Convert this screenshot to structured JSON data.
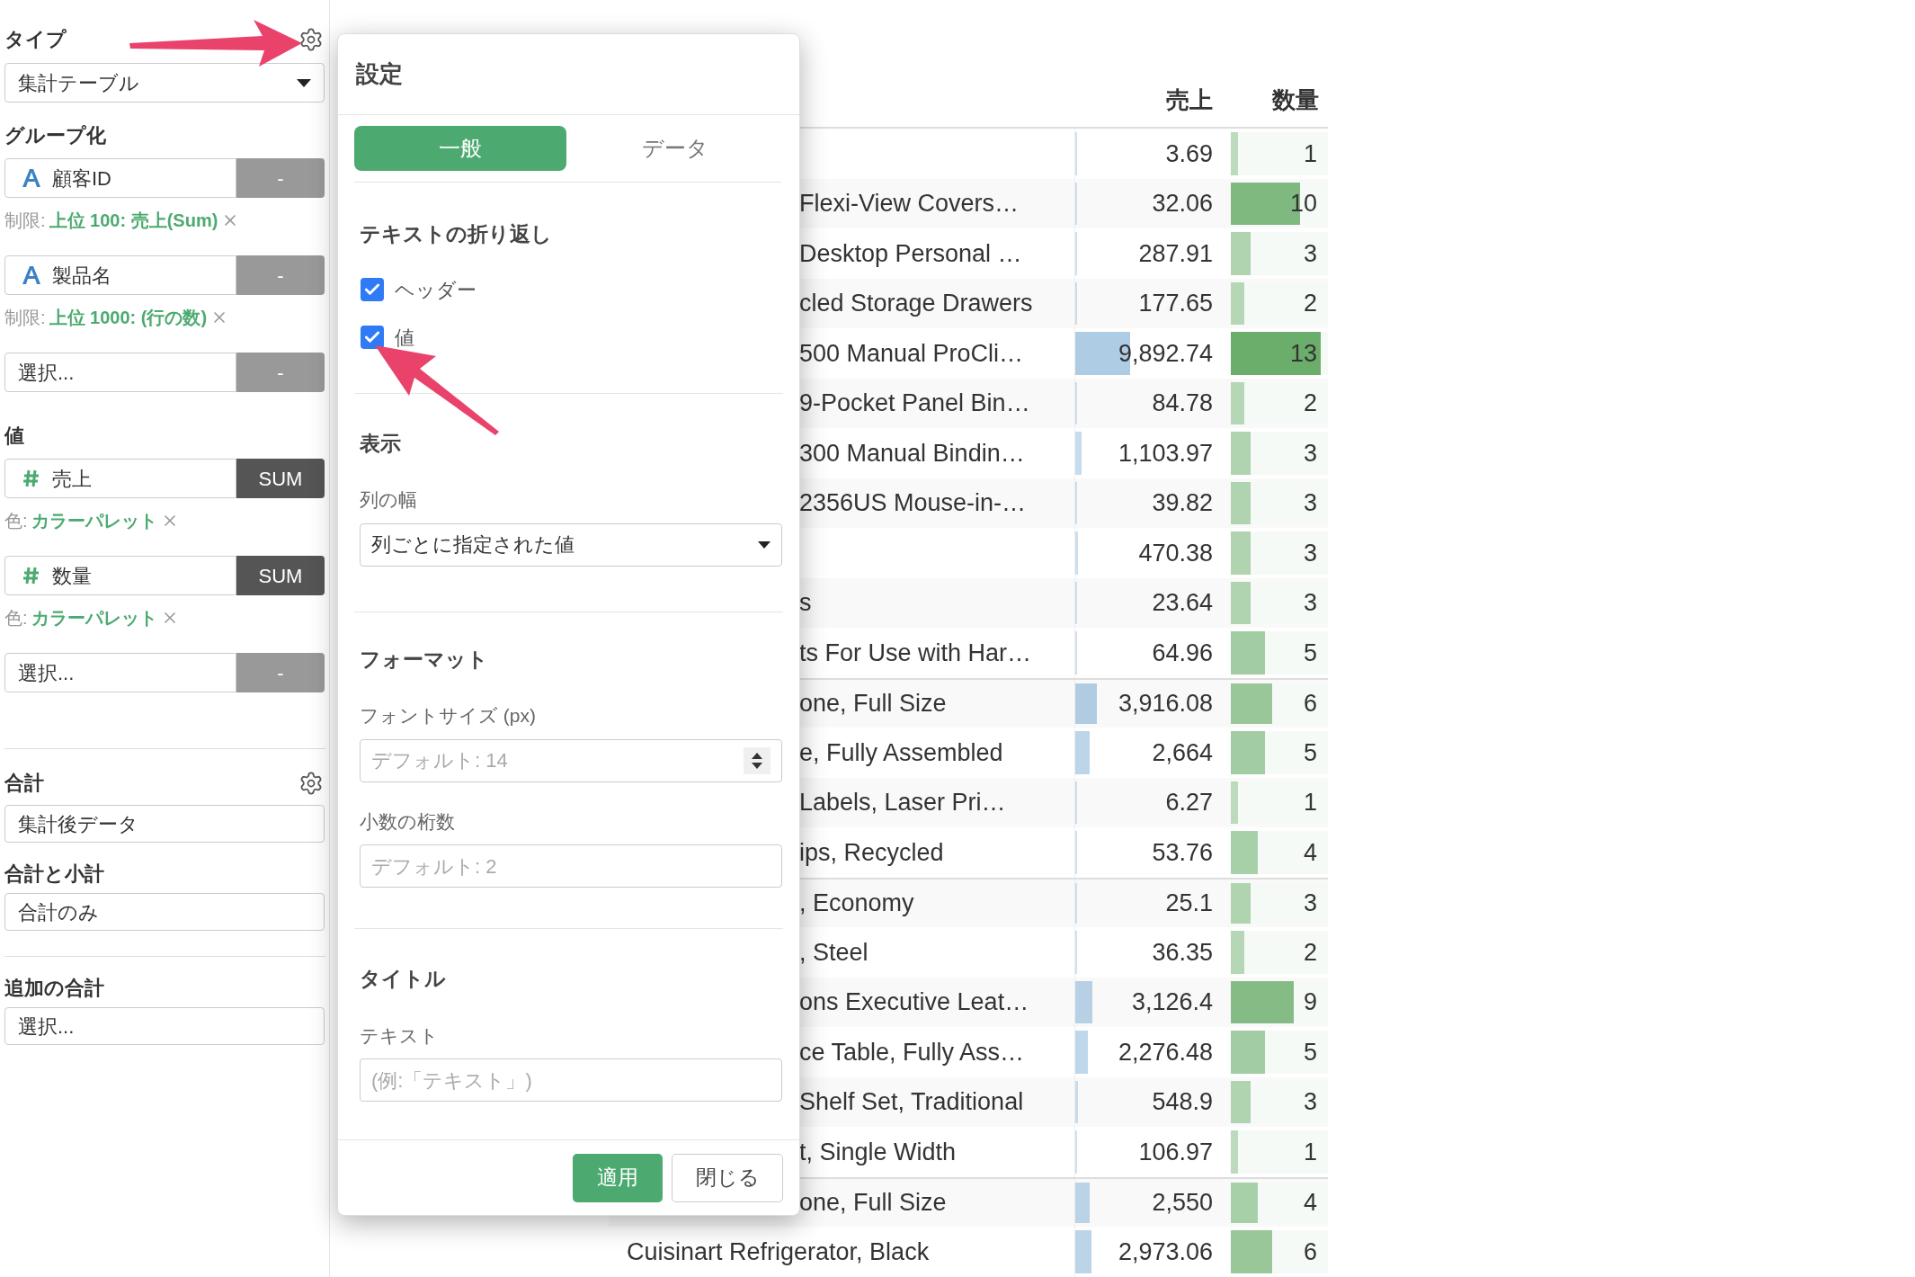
{
  "sidebar": {
    "type": {
      "label": "タイプ",
      "value": "集計テーブル"
    },
    "grouping": {
      "label": "グループ化",
      "fields": [
        {
          "kind": "text",
          "name": "顧客ID",
          "button": "-",
          "note_label": "制限:",
          "note_value": "上位 100: 売上(Sum)"
        },
        {
          "kind": "text",
          "name": "製品名",
          "button": "-",
          "note_label": "制限:",
          "note_value": "上位 1000: (行の数)"
        }
      ],
      "picker": {
        "placeholder": "選択...",
        "button": "-"
      }
    },
    "values": {
      "label": "値",
      "fields": [
        {
          "kind": "number",
          "name": "売上",
          "button": "SUM",
          "note_label": "色:",
          "note_value": "カラーパレット"
        },
        {
          "kind": "number",
          "name": "数量",
          "button": "SUM",
          "note_label": "色:",
          "note_value": "カラーパレット"
        }
      ],
      "picker": {
        "placeholder": "選択...",
        "button": "-"
      }
    },
    "totals": {
      "label": "合計",
      "value": "集計後データ"
    },
    "subtotals": {
      "label": "合計と小計",
      "value": "合計のみ"
    },
    "extra_totals": {
      "label": "追加の合計",
      "placeholder": "選択..."
    }
  },
  "dialog": {
    "title": "設定",
    "tabs": [
      {
        "label": "一般",
        "selected": true
      },
      {
        "label": "データ",
        "selected": false
      }
    ],
    "wrap": {
      "heading": "テキストの折り返し",
      "options": [
        {
          "label": "ヘッダー",
          "checked": true
        },
        {
          "label": "値",
          "checked": true
        }
      ]
    },
    "display": {
      "heading": "表示",
      "column_width_label": "列の幅",
      "column_width_value": "列ごとに指定された値"
    },
    "format": {
      "heading": "フォーマット",
      "font_size_label": "フォントサイズ (px)",
      "font_size_placeholder": "デフォルト: 14",
      "decimals_label": "小数の桁数",
      "decimals_placeholder": "デフォルト: 2"
    },
    "title_section": {
      "heading": "タイトル",
      "text_label": "テキスト",
      "text_placeholder": "(例:「テキスト」)"
    },
    "buttons": [
      {
        "label": "適用",
        "kind": "primary"
      },
      {
        "label": "閉じる",
        "kind": "secondary"
      }
    ]
  },
  "table": {
    "columns": [
      "売上",
      "数量"
    ],
    "groups": [
      {
        "rows": [
          {
            "name": "",
            "sales": "3.69",
            "sales_bar": {
              "level": 0.002
            },
            "qty": "1",
            "qty_bar": {
              "level": 0.07
            }
          },
          {
            "name": "Flexi-View Covers…",
            "sales": "32.06",
            "sales_bar": {
              "level": 0.004
            },
            "qty": "10",
            "qty_bar": {
              "level": 0.71
            }
          },
          {
            "name": "Desktop Personal …",
            "sales": "287.91",
            "sales_bar": {
              "level": 0.01
            },
            "qty": "3",
            "qty_bar": {
              "level": 0.2
            }
          },
          {
            "name": "cled Storage Drawers",
            "sales": "177.65",
            "sales_bar": {
              "level": 0.008
            },
            "qty": "2",
            "qty_bar": {
              "level": 0.14
            }
          },
          {
            "name": "500 Manual ProCli…",
            "sales": "9,892.74",
            "sales_bar": {
              "level": 0.35
            },
            "qty": "13",
            "qty_bar": {
              "level": 0.93
            }
          },
          {
            "name": "9-Pocket Panel Bin…",
            "sales": "84.78",
            "sales_bar": {
              "level": 0.005
            },
            "qty": "2",
            "qty_bar": {
              "level": 0.14
            }
          },
          {
            "name": "300 Manual Bindin…",
            "sales": "1,103.97",
            "sales_bar": {
              "level": 0.04
            },
            "qty": "3",
            "qty_bar": {
              "level": 0.2
            }
          },
          {
            "name": "2356US Mouse-in-…",
            "sales": "39.82",
            "sales_bar": {
              "level": 0.004
            },
            "qty": "3",
            "qty_bar": {
              "level": 0.2
            }
          },
          {
            "name": "",
            "sales": "470.38",
            "sales_bar": {
              "level": 0.017
            },
            "qty": "3",
            "qty_bar": {
              "level": 0.2
            }
          },
          {
            "name": "s",
            "sales": "23.64",
            "sales_bar": {
              "level": 0.003
            },
            "qty": "3",
            "qty_bar": {
              "level": 0.2
            }
          },
          {
            "name": "ts For Use with Har…",
            "sales": "64.96",
            "sales_bar": {
              "level": 0.004
            },
            "qty": "5",
            "qty_bar": {
              "level": 0.35
            }
          }
        ]
      },
      {
        "rows": [
          {
            "name": "one, Full Size",
            "sales": "3,916.08",
            "sales_bar": {
              "level": 0.14
            },
            "qty": "6",
            "qty_bar": {
              "level": 0.43
            }
          },
          {
            "name": "e, Fully Assembled",
            "sales": "2,664",
            "sales_bar": {
              "level": 0.095
            },
            "qty": "5",
            "qty_bar": {
              "level": 0.35
            }
          },
          {
            "name": "Labels, Laser Pri…",
            "sales": "6.27",
            "sales_bar": {
              "level": 0.002
            },
            "qty": "1",
            "qty_bar": {
              "level": 0.07
            }
          },
          {
            "name": "ips, Recycled",
            "sales": "53.76",
            "sales_bar": {
              "level": 0.004
            },
            "qty": "4",
            "qty_bar": {
              "level": 0.28
            }
          }
        ]
      },
      {
        "rows": [
          {
            "name": ", Economy",
            "sales": "25.1",
            "sales_bar": {
              "level": 0.003
            },
            "qty": "3",
            "qty_bar": {
              "level": 0.2
            }
          },
          {
            "name": ", Steel",
            "sales": "36.35",
            "sales_bar": {
              "level": 0.003
            },
            "qty": "2",
            "qty_bar": {
              "level": 0.14
            }
          },
          {
            "name": "ons Executive Leat…",
            "sales": "3,126.4",
            "sales_bar": {
              "level": 0.11
            },
            "qty": "9",
            "qty_bar": {
              "level": 0.65
            }
          },
          {
            "name": "ce Table, Fully Ass…",
            "sales": "2,276.48",
            "sales_bar": {
              "level": 0.08
            },
            "qty": "5",
            "qty_bar": {
              "level": 0.35
            }
          },
          {
            "name": "Shelf Set, Traditional",
            "sales": "548.9",
            "sales_bar": {
              "level": 0.02
            },
            "qty": "3",
            "qty_bar": {
              "level": 0.2
            }
          },
          {
            "name": "t, Single Width",
            "sales": "106.97",
            "sales_bar": {
              "level": 0.006
            },
            "qty": "1",
            "qty_bar": {
              "level": 0.07
            }
          }
        ]
      },
      {
        "rows": [
          {
            "name": "one, Full Size",
            "sales": "2,550",
            "sales_bar": {
              "level": 0.09
            },
            "qty": "4",
            "qty_bar": {
              "level": 0.28
            }
          },
          {
            "name": "Cuisinart Refrigerator, Black",
            "sales": "2,973.06",
            "sales_bar": {
              "level": 0.105
            },
            "qty": "6",
            "qty_bar": {
              "level": 0.43
            }
          }
        ]
      }
    ]
  }
}
